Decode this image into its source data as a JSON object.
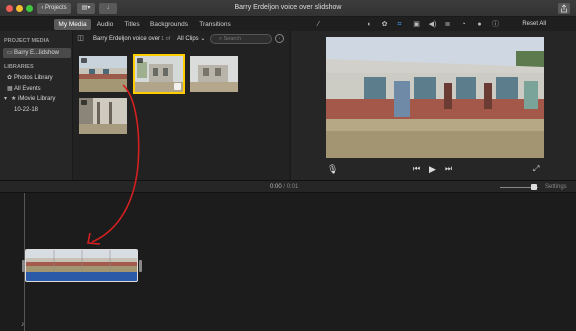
{
  "window": {
    "title": "Barry Erdeljon voice over slidshow",
    "projects_label": "Projects",
    "view_icon": "view-switcher-icon",
    "import_icon": "import-down-arrow-icon",
    "share_icon": "share-icon"
  },
  "tabs": [
    {
      "label": "My Media",
      "active": true
    },
    {
      "label": "Audio",
      "active": false
    },
    {
      "label": "Titles",
      "active": false
    },
    {
      "label": "Backgrounds",
      "active": false
    },
    {
      "label": "Transitions",
      "active": false
    }
  ],
  "viewer_toolbar": {
    "icons": [
      "magic-wand-icon",
      "color-balance-icon",
      "color-correction-icon",
      "crop-icon",
      "stabilization-icon",
      "volume-icon",
      "noise-reduction-icon",
      "speed-icon",
      "filter-icon",
      "info-icon"
    ],
    "reset_label": "Reset All"
  },
  "sidebar": {
    "project_media_heading": "PROJECT MEDIA",
    "project_item": "Barry E...lidshow",
    "libraries_heading": "LIBRARIES",
    "items": [
      {
        "label": "Photos Library",
        "icon": "photos-icon"
      },
      {
        "label": "All Events",
        "icon": "events-icon"
      },
      {
        "label": "iMovie Library",
        "icon": "library-star-icon"
      },
      {
        "label": "10-22-18",
        "icon": ""
      }
    ]
  },
  "browser": {
    "title": "Barry Erdeljon voice over",
    "count": "1 of",
    "clips_filter": "All Clips",
    "search_placeholder": "Search",
    "thumbs": 4
  },
  "timeline": {
    "timecode_current": "0:00",
    "timecode_separator": "/",
    "timecode_total": "0:01",
    "settings_label": "Settings"
  },
  "colors": {
    "selection": "#ffcc00",
    "clip_blue": "#2b5aa8",
    "annotation_red": "#d42020"
  }
}
